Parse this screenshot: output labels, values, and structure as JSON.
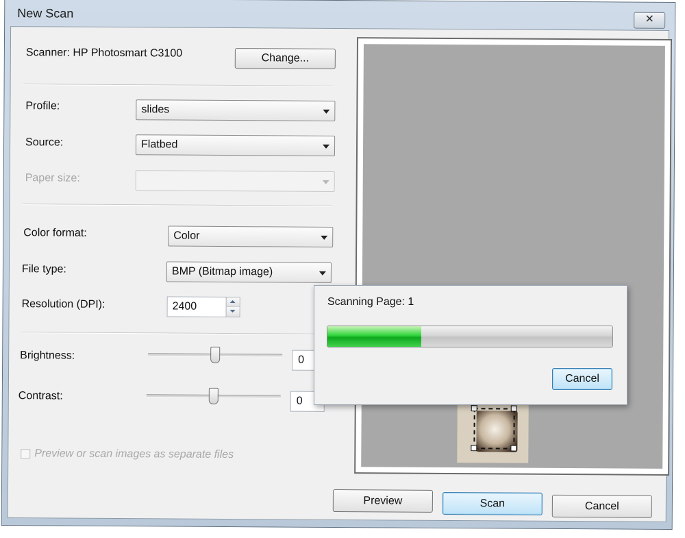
{
  "window": {
    "title": "New Scan",
    "close_glyph": "✕"
  },
  "scanner": {
    "label": "Scanner: HP Photosmart C3100",
    "change_label": "Change..."
  },
  "profile": {
    "label": "Profile:",
    "value": "slides"
  },
  "source": {
    "label": "Source:",
    "value": "Flatbed"
  },
  "paper_size": {
    "label": "Paper size:",
    "value": ""
  },
  "color_format": {
    "label": "Color format:",
    "value": "Color"
  },
  "file_type": {
    "label": "File type:",
    "value": "BMP (Bitmap image)"
  },
  "resolution": {
    "label": "Resolution (DPI):",
    "value": "2400"
  },
  "brightness": {
    "label": "Brightness:",
    "value": "0",
    "level": 0.5
  },
  "contrast": {
    "label": "Contrast:",
    "value": "0",
    "level": 0.5
  },
  "separate_files": {
    "label": "Preview or scan images as separate files",
    "checked": false
  },
  "progress": {
    "label": "Scanning Page: 1",
    "fraction": 0.33,
    "cancel_label": "Cancel"
  },
  "buttons": {
    "preview": "Preview",
    "scan": "Scan",
    "cancel": "Cancel"
  }
}
